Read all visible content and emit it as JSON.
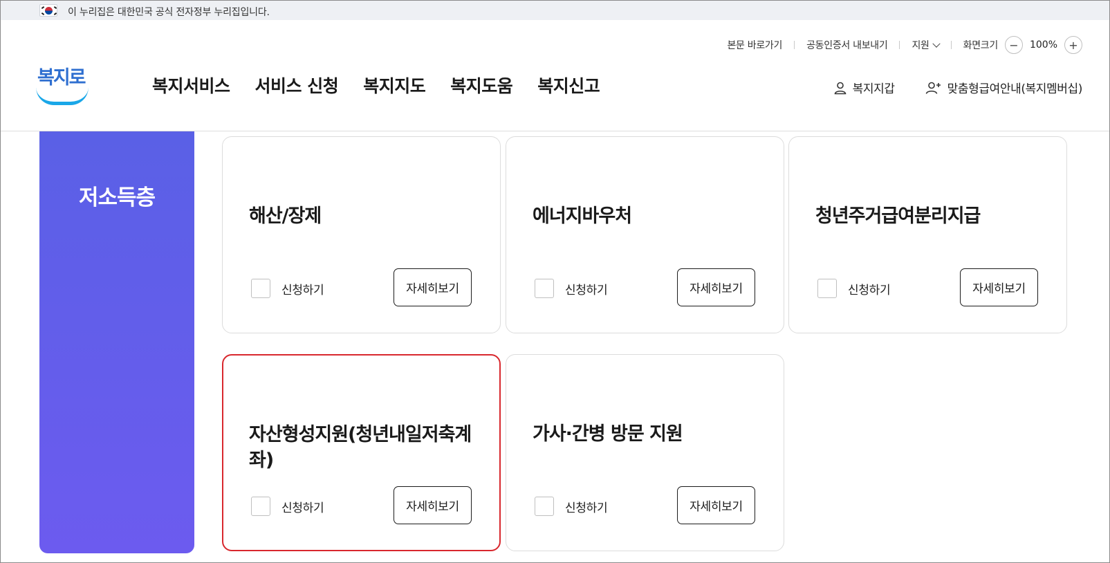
{
  "gov_banner": {
    "text": "이 누리집은 대한민국 공식 전자정부 누리집입니다."
  },
  "utility": {
    "skip_link": "본문 바로가기",
    "cert_export": "공동인증서 내보내기",
    "support": "지원",
    "screen_size": "화면크기",
    "zoom_out": "−",
    "zoom_value": "100%",
    "zoom_in": "+"
  },
  "logo": {
    "text": "복지로"
  },
  "gnb": {
    "items": [
      "복지서비스",
      "서비스 신청",
      "복지지도",
      "복지도움",
      "복지신고"
    ]
  },
  "header_right": {
    "wallet": "복지지갑",
    "membership": "맞춤형급여안내(복지멤버십)"
  },
  "side": {
    "title": "저소득층"
  },
  "cards": [
    {
      "title": "해산/장제",
      "apply_label": "신청하기",
      "detail_label": "자세히보기",
      "checked": false
    },
    {
      "title": "에너지바우처",
      "apply_label": "신청하기",
      "detail_label": "자세히보기",
      "checked": false
    },
    {
      "title": "청년주거급여분리지급",
      "apply_label": "신청하기",
      "detail_label": "자세히보기",
      "checked": false
    },
    {
      "title": "자산형성지원(청년내일저축계좌)",
      "apply_label": "신청하기",
      "detail_label": "자세히보기",
      "checked": false,
      "selected": true
    },
    {
      "title": "가사·간병 방문 지원",
      "apply_label": "신청하기",
      "detail_label": "자세히보기",
      "checked": false
    }
  ],
  "colors": {
    "side_gradient_top": "#5a60e6",
    "side_gradient_bottom": "#6c5bef",
    "selected_border": "#d8272d",
    "logo_blue": "#2f6fd0",
    "logo_smile": "#1aa7e8"
  }
}
